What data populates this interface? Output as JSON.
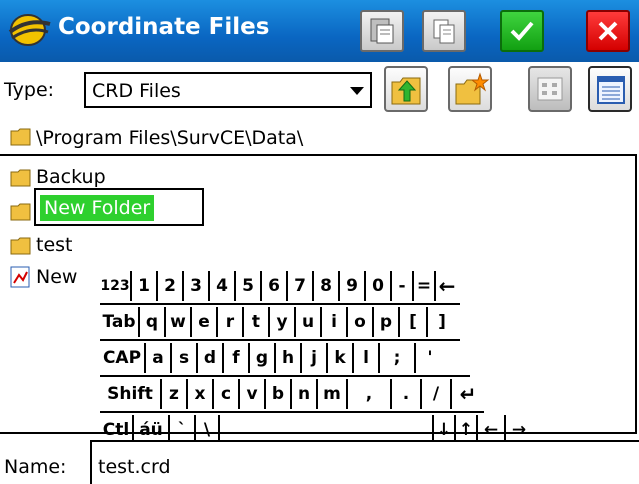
{
  "window": {
    "title": "Coordinate Files"
  },
  "toolbar": {
    "type_label": "Type:",
    "type_value": "CRD Files"
  },
  "path": "\\Program Files\\SurvCE\\Data\\",
  "list": {
    "folders": [
      "Backup",
      "New Folder",
      "test"
    ],
    "partial_item": "New"
  },
  "keyboard": {
    "rows": [
      [
        "123",
        "1",
        "2",
        "3",
        "4",
        "5",
        "6",
        "7",
        "8",
        "9",
        "0",
        "-",
        "=",
        "←"
      ],
      [
        "Tab",
        "q",
        "w",
        "e",
        "r",
        "t",
        "y",
        "u",
        "i",
        "o",
        "p",
        "[",
        "]"
      ],
      [
        "CAP",
        "a",
        "s",
        "d",
        "f",
        "g",
        "h",
        "j",
        "k",
        "l",
        ";",
        "'"
      ],
      [
        "Shift",
        "z",
        "x",
        "c",
        "v",
        "b",
        "n",
        "m",
        ",",
        ".",
        "/",
        "↵"
      ],
      [
        "Ctl",
        "áü",
        "`",
        "\\",
        "",
        "↓",
        "↑",
        "←",
        "→"
      ]
    ]
  },
  "name": {
    "label": "Name:",
    "value": "test.crd"
  },
  "colors": {
    "title_bar": "#0a66c2",
    "ok_green": "#12a012",
    "cancel_red": "#d40000",
    "selection": "#2ed02e"
  }
}
